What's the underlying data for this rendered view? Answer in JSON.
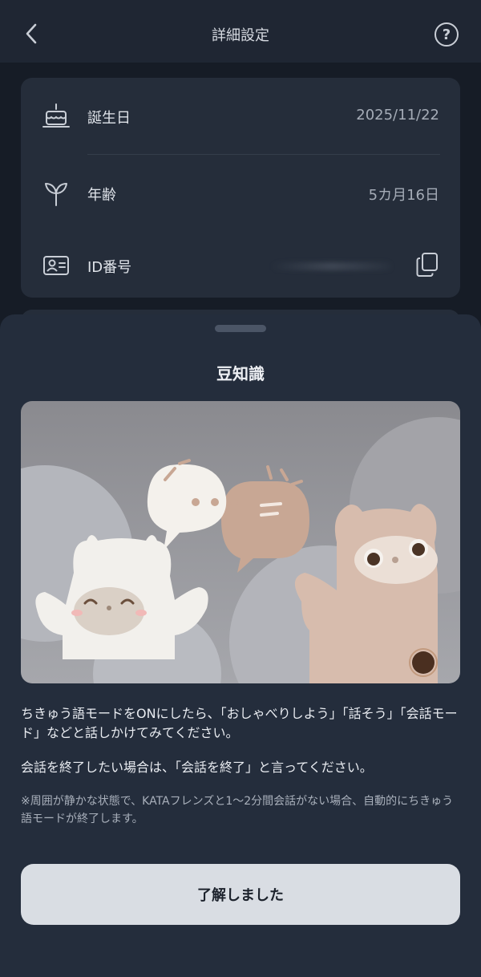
{
  "header": {
    "title": "詳細設定",
    "back_icon": "chevron-left-icon",
    "help_label": "?"
  },
  "settings": {
    "rows": [
      {
        "icon": "birthday-cake-icon",
        "label": "誕生日",
        "value": "2025/11/22"
      },
      {
        "icon": "sprout-icon",
        "label": "年齢",
        "value": "5カ月16日"
      },
      {
        "icon": "id-card-icon",
        "label": "ID番号",
        "value": ""
      }
    ],
    "copy_icon": "copy-icon"
  },
  "sheet": {
    "title": "豆知識",
    "text1": "ちきゅう語モードをONにしたら、「おしゃべりしよう」「話そう」「会話モード」などと話しかけてみてください。",
    "text2": "会話を終了したい場合は、「会話を終了」と言ってください。",
    "note": "※周囲が静かな状態で、KATAフレンズと1〜2分間会話がない場合、自動的にちきゅう語モードが終了します。",
    "button_label": "了解しました"
  },
  "colors": {
    "background": "#161c26",
    "card": "#252d3a",
    "sheet": "#242d3c",
    "button": "#d9dde3"
  }
}
